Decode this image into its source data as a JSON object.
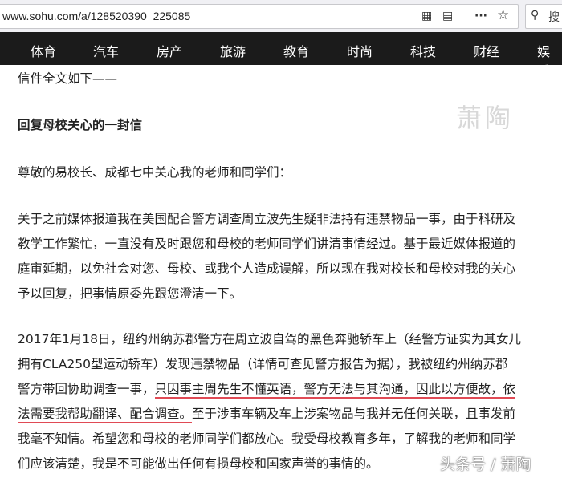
{
  "browser": {
    "url": "www.sohu.com/a/128520390_225085",
    "search_placeholder": "搜",
    "icons": [
      "qr-code-icon",
      "reader-icon",
      "more-icon",
      "star-icon",
      "search-icon"
    ],
    "more": "···",
    "star": "☆",
    "reader": "▤",
    "qr": "▦",
    "search_glyph": "⚲"
  },
  "nav": [
    "体育",
    "汽车",
    "房产",
    "旅游",
    "教育",
    "时尚",
    "科技",
    "财经",
    "娱乐"
  ],
  "article": {
    "intro": "信件全文如下——",
    "title": "回复母校关心的一封信",
    "greeting": "尊敬的易校长、成都七中关心我的老师和同学们：",
    "p1": [
      "关于之前媒体报道我在美国配合警方调查周立波先生疑非法持有违禁物品一事，由于科研及",
      "教学工作繁忙，一直没有及时跟您和母校的老师同学们讲清事情经过。基于最近媒体报道的",
      "庭审延期，以免社会对您、母校、或我个人造成误解，所以现在我对校长和母校对我的关心",
      "予以回复，把事情原委先跟您澄清一下。"
    ],
    "p2_1": "2017年1月18日，纽约州纳苏郡警方在周立波自驾的黑色奔驰轿车上（经警方证实为其女儿",
    "p2_2": "拥有CLA250型运动轿车）发现违禁物品（详情可查见警方报告为据），我被纽约州纳苏郡",
    "p2_3a": "警方带回协助调查一事，",
    "p2_3b": "只因事主周先生不懂英语，警方无法与其沟通，因此以方便故，依",
    "p2_4a": "法需要我帮助翻译、配合调查。",
    "p2_4b": "至于涉事车辆及车上涉案物品与我并无任何关联，且事发前",
    "p2_5": "我毫不知情。希望您和母校的老师同学们都放心。我受母校教育多年，了解我的老师和同学",
    "p2_6": "们应该清楚，我是不可能做出任何有损母校和国家声誉的事情的。"
  },
  "watermarks": {
    "top": "萧陶",
    "bottom": "头条号 / 萧陶"
  },
  "colors": {
    "nav_bg": "#1b1b1b",
    "underline": "#e04a55"
  }
}
